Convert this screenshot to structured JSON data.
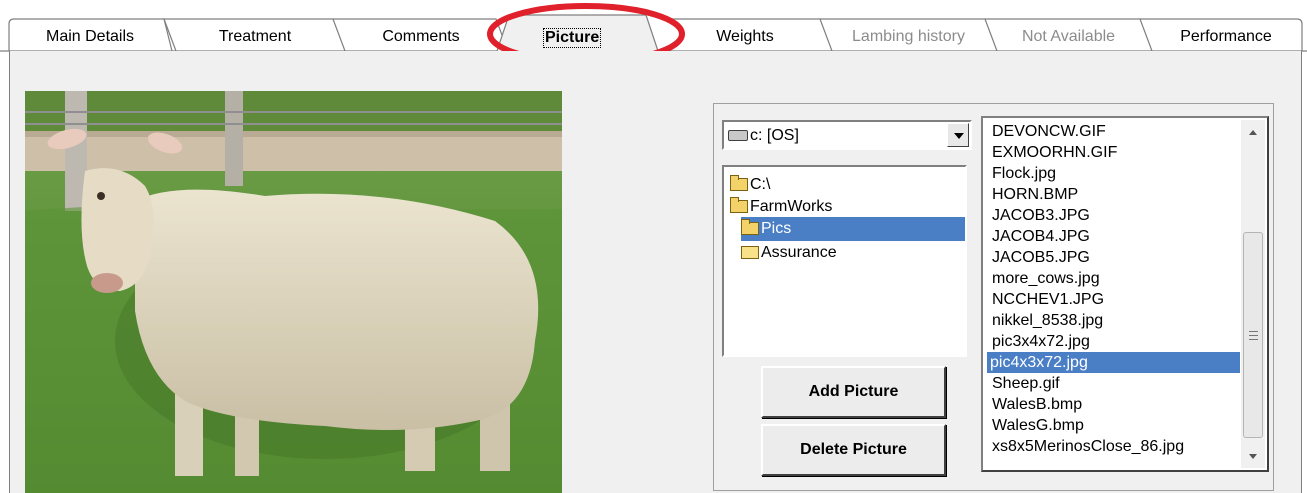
{
  "tabs": [
    {
      "label": "Main Details",
      "state": "normal"
    },
    {
      "label": "Treatment",
      "state": "normal"
    },
    {
      "label": "Comments",
      "state": "normal"
    },
    {
      "label": "Picture",
      "state": "active"
    },
    {
      "label": "Weights",
      "state": "normal"
    },
    {
      "label": "Lambing history",
      "state": "disabled"
    },
    {
      "label": "Not Available",
      "state": "disabled"
    },
    {
      "label": "Performance",
      "state": "normal"
    }
  ],
  "highlight_color": "#e0202a",
  "photo": {
    "subject": "sheep-photo"
  },
  "picker": {
    "drive": "c: [OS]",
    "folders": [
      {
        "label": "C:\\",
        "state": "open"
      },
      {
        "label": "FarmWorks",
        "state": "open"
      },
      {
        "label": "Pics",
        "state": "open-selected"
      },
      {
        "label": "Assurance",
        "state": "closed"
      }
    ],
    "files": [
      "DEVONCW.GIF",
      "EXMOORHN.GIF",
      "Flock.jpg",
      "HORN.BMP",
      "JACOB3.JPG",
      "JACOB4.JPG",
      "JACOB5.JPG",
      "more_cows.jpg",
      "NCCHEV1.JPG",
      "nikkel_8538.jpg",
      "pic3x4x72.jpg",
      "pic4x3x72.jpg",
      "Sheep.gif",
      "WalesB.bmp",
      "WalesG.bmp",
      "xs8x5MerinosClose_86.jpg"
    ],
    "selected_file": "pic4x3x72.jpg",
    "add_label": "Add Picture",
    "delete_label": "Delete Picture"
  }
}
